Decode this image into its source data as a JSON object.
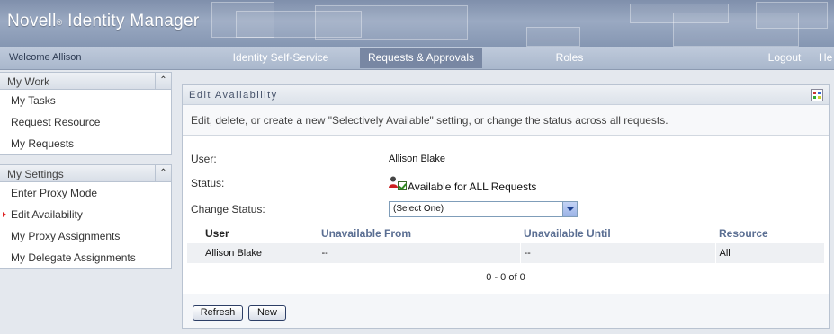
{
  "header": {
    "brand": "Novell",
    "brand_reg": "®",
    "product": " Identity Manager"
  },
  "nav": {
    "welcome": "Welcome Allison",
    "tabs": [
      {
        "label": "Identity Self-Service",
        "active": false
      },
      {
        "label": "Requests & Approvals",
        "active": true
      },
      {
        "label": "Roles",
        "active": false
      }
    ],
    "logout": "Logout",
    "help": "He"
  },
  "sidebar": {
    "my_work": {
      "title": "My Work",
      "items": [
        "My Tasks",
        "Request Resource",
        "My Requests"
      ]
    },
    "my_settings": {
      "title": "My Settings",
      "items": [
        "Enter Proxy Mode",
        "Edit Availability",
        "My Proxy Assignments",
        "My Delegate Assignments"
      ],
      "selected": "Edit Availability"
    }
  },
  "panel": {
    "title": "Edit Availability",
    "description": "Edit, delete, or create a new \"Selectively Available\" setting, or change the status across all requests.",
    "user_label": "User:",
    "user_value": "Allison Blake",
    "status_label": "Status:",
    "status_value": "Available for ALL Requests",
    "change_status_label": "Change Status:",
    "change_status_selected": "(Select One)",
    "table": {
      "headers": [
        "User",
        "Unavailable From",
        "Unavailable Until",
        "Resource"
      ],
      "rows": [
        [
          "Allison Blake",
          "--",
          "--",
          "All"
        ]
      ]
    },
    "pager": "0 - 0 of 0",
    "buttons": {
      "refresh": "Refresh",
      "new": "New"
    }
  },
  "colors": {
    "banner": "#8596b2",
    "nav_active": "#7887a3",
    "column_header": "#5a6e92",
    "selected_arrow": "#dd2222"
  }
}
